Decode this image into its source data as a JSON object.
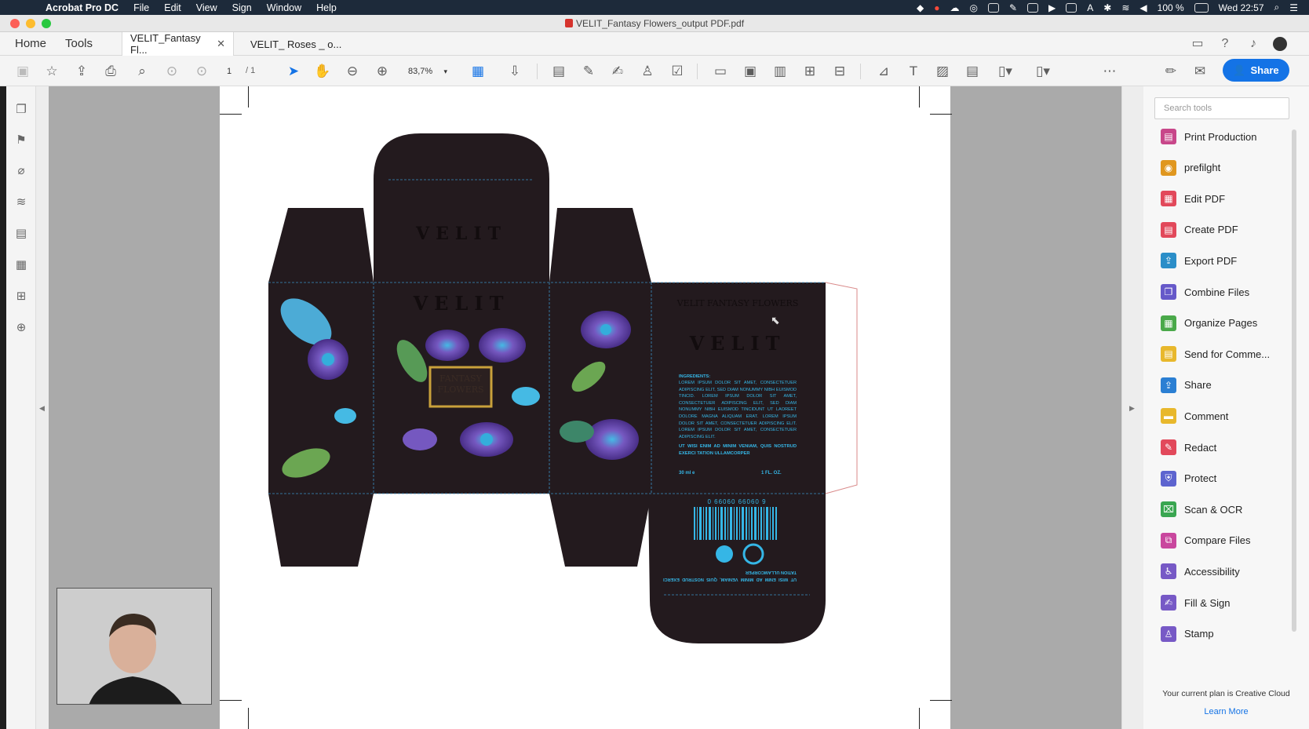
{
  "menubar": {
    "app_name": "Acrobat Pro DC",
    "items": [
      "File",
      "Edit",
      "View",
      "Sign",
      "Window",
      "Help"
    ],
    "battery": "100 %",
    "clock": "Wed 22:57"
  },
  "window": {
    "title": "VELIT_Fantasy Flowers_output PDF.pdf"
  },
  "tabs": {
    "home": "Home",
    "tools": "Tools",
    "documents": [
      {
        "label": "VELIT_Fantasy Fl...",
        "active": true
      },
      {
        "label": "VELIT_ Roses _ o...",
        "active": false
      }
    ]
  },
  "toolbar": {
    "page_current": "1",
    "page_total": "/ 1",
    "zoom": "83,7%",
    "share_label": "Share"
  },
  "document": {
    "brand": "VELIT",
    "product_line": "VELIT FANTASY FLOWERS",
    "front_label": "FANTASY FLOWERS",
    "ingredients_title": "INGREDIENTS:",
    "ingredients_text": "LOREM IPSUM DOLOR SIT AMET, CONSECTETUER ADIPISCING ELIT, SED DIAM NONUMMY NIBH EUISMOD TINCID. LOREM IPSUM DOLOR SIT AMET, CONSECTETUER ADIPISCING ELIT, SED DIAM NONUMMY NIBH EUISMOD TINCIDUNT UT LAOREET DOLORE MAGNA ALIQUAM ERAT. LOREM IPSUM DOLOR SIT AMET, CONSECTETUER ADIPISCING ELIT. LOREM IPSUM DOLOR SIT AMET, CONSECTETUER ADIPISCING ELIT.",
    "tagline": "UT WISI ENIM AD MINIM VENIAM, QUIS NOSTRUD EXERCI TATION ULLAMCORPER",
    "volume_ml": "30 ml e",
    "volume_oz": "1 FL. OZ.",
    "barcode": "0 66060 66060 9",
    "tagline_flipped": "UT WISI ENIM AD MINIM VENIAM, QUIS NOSTRUD EXERCI TATION ULLAMCORPER"
  },
  "tools_pane": {
    "search_placeholder": "Search tools",
    "tools": [
      {
        "label": "Print Production",
        "icon": "print-production-icon",
        "color": "#c8478a"
      },
      {
        "label": "prefilght",
        "icon": "preflight-icon",
        "color": "#e0971f"
      },
      {
        "label": "Edit PDF",
        "icon": "edit-pdf-icon",
        "color": "#e2495b"
      },
      {
        "label": "Create PDF",
        "icon": "create-pdf-icon",
        "color": "#e2495b"
      },
      {
        "label": "Export PDF",
        "icon": "export-pdf-icon",
        "color": "#2b8ec8"
      },
      {
        "label": "Combine Files",
        "icon": "combine-files-icon",
        "color": "#6659c9"
      },
      {
        "label": "Organize Pages",
        "icon": "organize-pages-icon",
        "color": "#4aa94a"
      },
      {
        "label": "Send for Comme...",
        "icon": "send-for-comment-icon",
        "color": "#e8b82c"
      },
      {
        "label": "Share",
        "icon": "share-icon",
        "color": "#2b7fd3"
      },
      {
        "label": "Comment",
        "icon": "comment-icon",
        "color": "#e8b82c"
      },
      {
        "label": "Redact",
        "icon": "redact-icon",
        "color": "#e2495b"
      },
      {
        "label": "Protect",
        "icon": "protect-icon",
        "color": "#5d64cf"
      },
      {
        "label": "Scan & OCR",
        "icon": "scan-ocr-icon",
        "color": "#3aa651"
      },
      {
        "label": "Compare Files",
        "icon": "compare-files-icon",
        "color": "#c9479e"
      },
      {
        "label": "Accessibility",
        "icon": "accessibility-icon",
        "color": "#7759c6"
      },
      {
        "label": "Fill & Sign",
        "icon": "fill-sign-icon",
        "color": "#7759c6"
      },
      {
        "label": "Stamp",
        "icon": "stamp-icon",
        "color": "#7759c6"
      }
    ],
    "plan_text": "Your current plan is Creative Cloud",
    "learn_more": "Learn More"
  },
  "colors": {
    "accent": "#1473e6",
    "box_dark": "#231a1e",
    "gold": "#c9a13b",
    "cyan": "#35b6e6"
  }
}
